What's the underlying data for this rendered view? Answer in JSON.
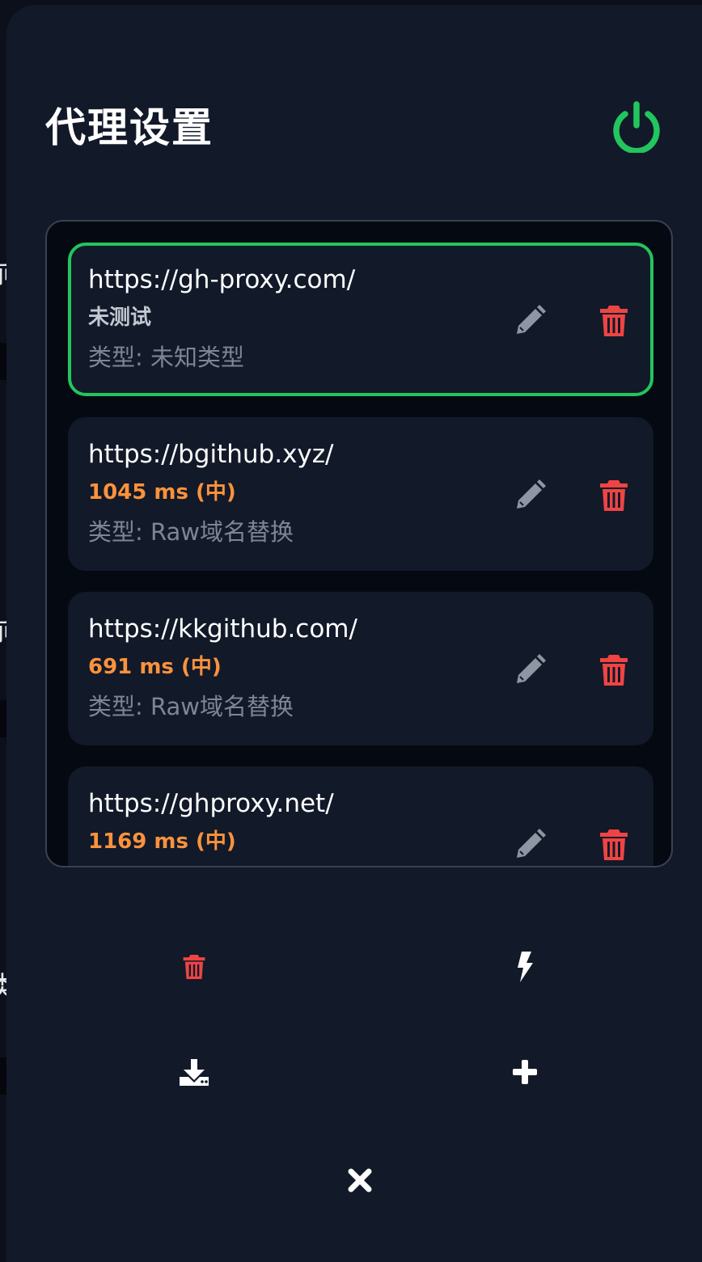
{
  "dialog": {
    "title": "代理设置"
  },
  "proxies": [
    {
      "url": "https://gh-proxy.com/",
      "status": "未测试",
      "type": "类型: 未知类型",
      "selected": true
    },
    {
      "url": "https://bgithub.xyz/",
      "status": "1045 ms (中)",
      "type": "类型: Raw域名替换",
      "selected": false
    },
    {
      "url": "https://kkgithub.com/",
      "status": "691 ms (中)",
      "type": "类型: Raw域名替换",
      "selected": false
    },
    {
      "url": "https://ghproxy.net/",
      "status": "1169 ms (中)",
      "type": "",
      "selected": false
    }
  ],
  "icons": {
    "power": "power-icon",
    "edit": "pencil-icon",
    "delete": "trash-icon",
    "clear_all": "trash-icon",
    "test_speed": "bolt-icon",
    "import": "download-icon",
    "add": "plus-icon",
    "close": "close-icon"
  },
  "colors": {
    "accent_green": "#22c55e",
    "danger_red": "#ef4444",
    "latency_orange": "#fb923c",
    "panel_bg": "#121929",
    "list_bg": "#050911"
  }
}
